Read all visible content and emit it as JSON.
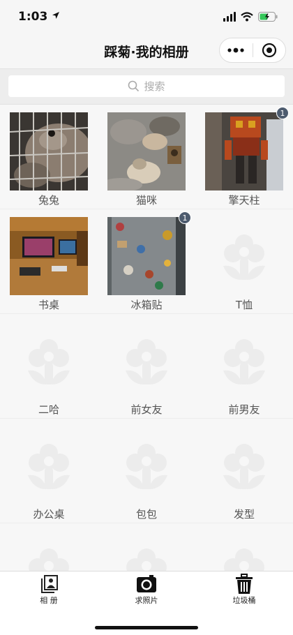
{
  "status": {
    "time": "1:03"
  },
  "nav": {
    "title": "踩菊·我的相册"
  },
  "search": {
    "placeholder": "搜索"
  },
  "albums": [
    {
      "label": "兔兔",
      "badge": null,
      "photo": "rabbit"
    },
    {
      "label": "猫咪",
      "badge": null,
      "photo": "cats"
    },
    {
      "label": "擎天柱",
      "badge": "1",
      "photo": "robot"
    },
    {
      "label": "书桌",
      "badge": null,
      "photo": "desk"
    },
    {
      "label": "冰箱贴",
      "badge": "1",
      "photo": "magnets"
    },
    {
      "label": "T恤",
      "badge": null,
      "photo": null
    },
    {
      "label": "二哈",
      "badge": null,
      "photo": null
    },
    {
      "label": "前女友",
      "badge": null,
      "photo": null
    },
    {
      "label": "前男友",
      "badge": null,
      "photo": null
    },
    {
      "label": "办公桌",
      "badge": null,
      "photo": null
    },
    {
      "label": "包包",
      "badge": null,
      "photo": null
    },
    {
      "label": "发型",
      "badge": null,
      "photo": null
    },
    {
      "label": "",
      "badge": null,
      "photo": null
    },
    {
      "label": "",
      "badge": null,
      "photo": null
    },
    {
      "label": "",
      "badge": null,
      "photo": null
    }
  ],
  "tabs": [
    {
      "label": "相 册",
      "icon": "album-icon"
    },
    {
      "label": "求照片",
      "icon": "camera-icon"
    },
    {
      "label": "垃圾桶",
      "icon": "trash-icon"
    }
  ]
}
